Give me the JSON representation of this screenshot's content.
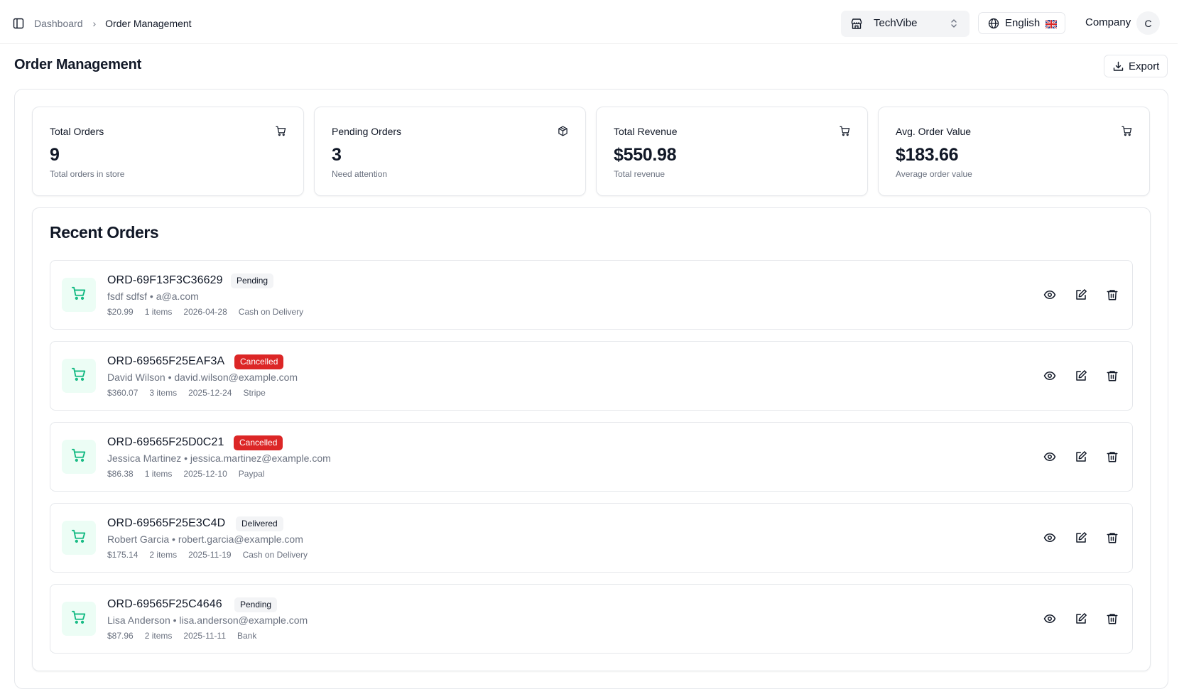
{
  "header": {
    "breadcrumb": {
      "home": "Dashboard",
      "separator": "›",
      "current": "Order Management"
    },
    "store_selector": {
      "value": "TechVibe"
    },
    "language": {
      "label": "English"
    },
    "company_label": "Company",
    "avatar_initial": "C"
  },
  "page": {
    "title": "Order Management",
    "export_label": "Export"
  },
  "stats": [
    {
      "title": "Total Orders",
      "value": "9",
      "subtitle": "Total orders in store",
      "icon": "cart-icon"
    },
    {
      "title": "Pending Orders",
      "value": "3",
      "subtitle": "Need attention",
      "icon": "package-icon"
    },
    {
      "title": "Total Revenue",
      "value": "$550.98",
      "subtitle": "Total revenue",
      "icon": "cart-icon"
    },
    {
      "title": "Avg. Order Value",
      "value": "$183.66",
      "subtitle": "Average order value",
      "icon": "cart-icon"
    }
  ],
  "orders_section": {
    "title": "Recent Orders",
    "orders": [
      {
        "id": "ORD-69F13F3C36629",
        "status": "Pending",
        "customer": "fsdf sdfsf • a@a.com",
        "amount": "$20.99",
        "items": "1 items",
        "date": "2026-04-28",
        "payment": "Cash on Delivery"
      },
      {
        "id": "ORD-69565F25EAF3A",
        "status": "Cancelled",
        "customer": "David Wilson • david.wilson@example.com",
        "amount": "$360.07",
        "items": "3 items",
        "date": "2025-12-24",
        "payment": "Stripe"
      },
      {
        "id": "ORD-69565F25D0C21",
        "status": "Cancelled",
        "customer": "Jessica Martinez • jessica.martinez@example.com",
        "amount": "$86.38",
        "items": "1 items",
        "date": "2025-12-10",
        "payment": "Paypal"
      },
      {
        "id": "ORD-69565F25E3C4D",
        "status": "Delivered",
        "customer": "Robert Garcia • robert.garcia@example.com",
        "amount": "$175.14",
        "items": "2 items",
        "date": "2025-11-19",
        "payment": "Cash on Delivery"
      },
      {
        "id": "ORD-69565F25C4646",
        "status": "Pending",
        "customer": "Lisa Anderson • lisa.anderson@example.com",
        "amount": "$87.96",
        "items": "2 items",
        "date": "2025-11-11",
        "payment": "Bank"
      }
    ]
  },
  "colors": {
    "accent_green": "#10b981",
    "cart_bg": "#ecfdf5",
    "danger": "#dc2626",
    "neutral_badge": "#f3f4f6",
    "muted_text": "#6b7280"
  }
}
